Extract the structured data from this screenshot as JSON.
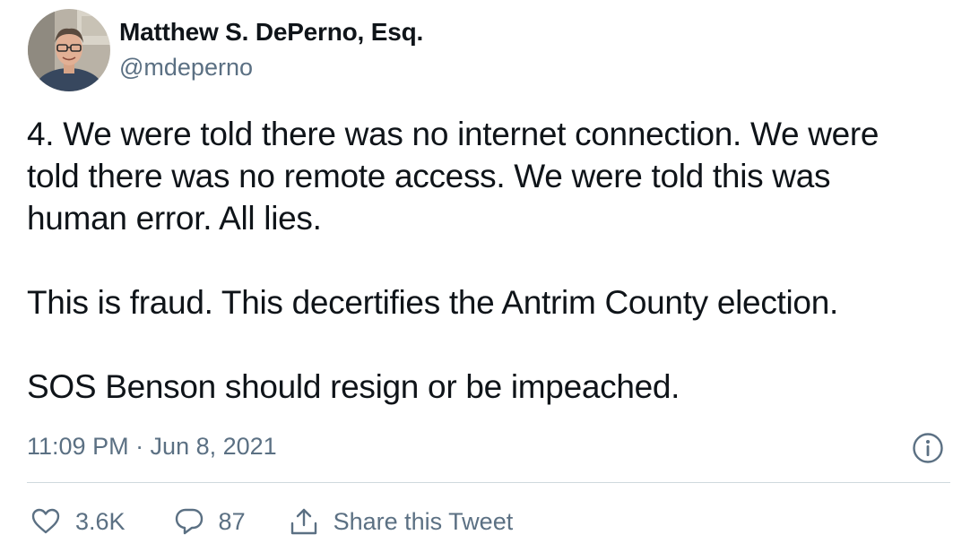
{
  "tweet": {
    "author": {
      "name": "Matthew S. DePerno, Esq.",
      "handle": "@mdeperno"
    },
    "text": {
      "paragraph1_line1": "4. We were told there was no internet connection. We were",
      "paragraph1_line2": "told there was no remote access. We were told this was",
      "paragraph1_line3": "human error. All lies.",
      "paragraph2": "This is fraud. This decertifies the Antrim County election.",
      "paragraph3": "SOS Benson should resign or be impeached."
    },
    "timestamp": "11:09 PM · Jun 8, 2021",
    "actions": {
      "likes": "3.6K",
      "replies": "87",
      "share_label": "Share this Tweet"
    },
    "icons": {
      "info": "info-icon",
      "like": "heart-icon",
      "reply": "speech-bubble-icon",
      "share": "share-upload-icon"
    },
    "colors": {
      "text": "#0f1419",
      "secondary": "#5b7083",
      "divider": "#cfd9de"
    }
  }
}
